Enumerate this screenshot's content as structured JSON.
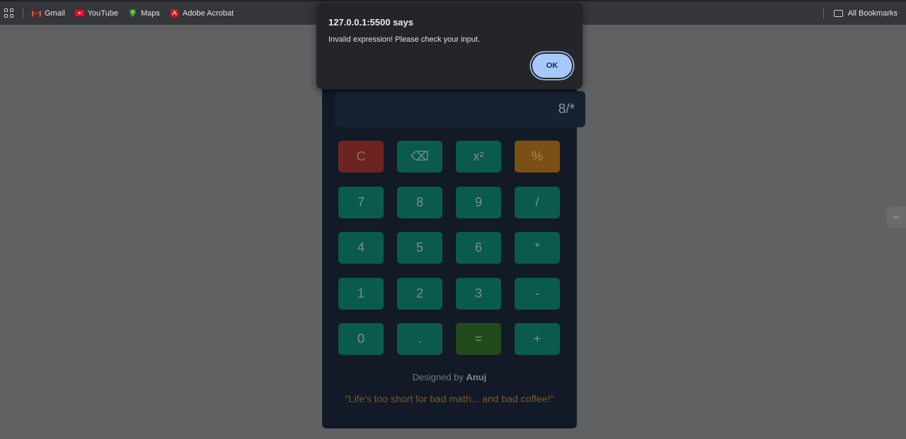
{
  "bookmarks_bar": {
    "items": [
      {
        "label": "Gmail",
        "icon": "gmail-icon"
      },
      {
        "label": "YouTube",
        "icon": "youtube-icon"
      },
      {
        "label": "Maps",
        "icon": "maps-icon"
      },
      {
        "label": "Adobe Acrobat",
        "icon": "acrobat-icon"
      }
    ],
    "all_bookmarks": "All Bookmarks"
  },
  "dialog": {
    "title": "127.0.0.1:5500 says",
    "message": "Invalid expression! Please check your input.",
    "ok_label": "OK"
  },
  "calculator": {
    "display_value": "8/*",
    "buttons": {
      "clear": "C",
      "backspace": "⌫",
      "square": "x²",
      "percent": "%",
      "seven": "7",
      "eight": "8",
      "nine": "9",
      "divide": "/",
      "four": "4",
      "five": "5",
      "six": "6",
      "multiply": "*",
      "one": "1",
      "two": "2",
      "three": "3",
      "subtract": "-",
      "zero": "0",
      "decimal": ".",
      "equals": "=",
      "add": "+"
    },
    "designed_by_prefix": "Designed by",
    "designer": "Anuj",
    "quote": "\"Life's too short for bad math... and bad coffee!\""
  },
  "colors": {
    "overlay": "#606163",
    "button": "#0b5a4e",
    "clear": "#6d2421",
    "percent": "#7c5014",
    "equals": "#234a1c",
    "ok_button": "#a8c7fa"
  }
}
